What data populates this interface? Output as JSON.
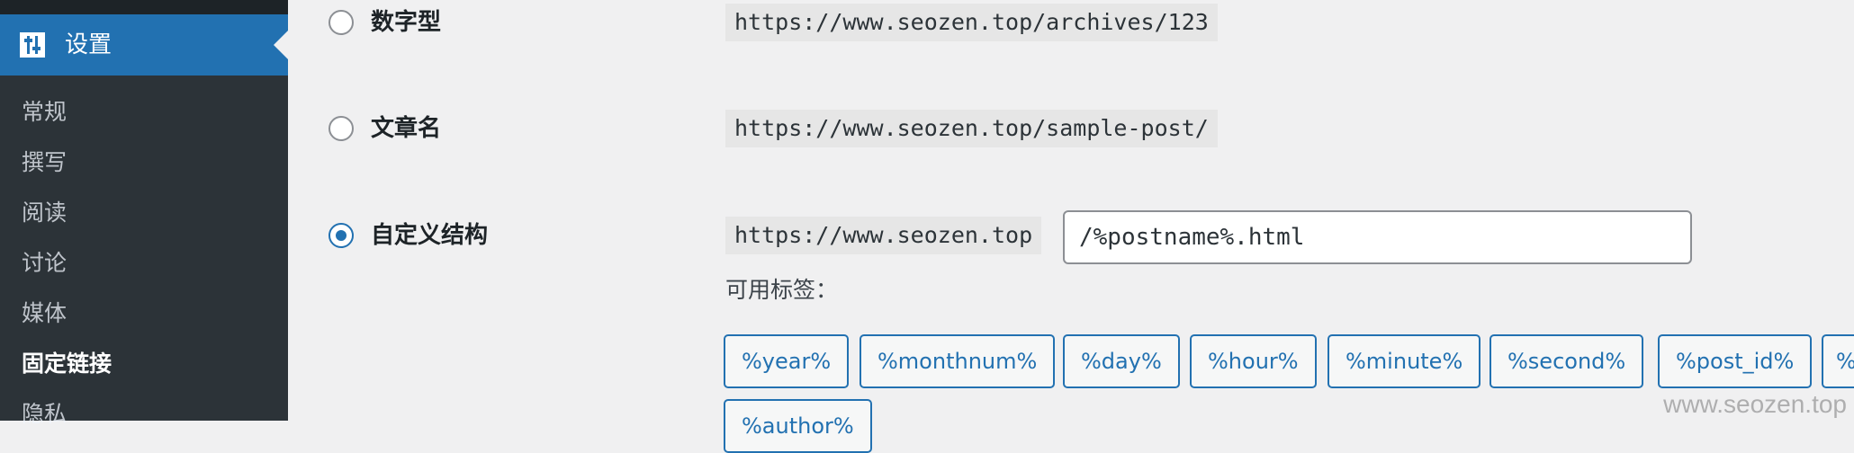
{
  "sidebar": {
    "current_section": {
      "label": "设置",
      "icon": "settings-sliders-icon"
    },
    "items": [
      {
        "label": "常规"
      },
      {
        "label": "撰写"
      },
      {
        "label": "阅读"
      },
      {
        "label": "讨论"
      },
      {
        "label": "媒体"
      },
      {
        "label": "固定链接",
        "current": true
      },
      {
        "label": "隐私"
      }
    ]
  },
  "permalinks": {
    "options": [
      {
        "label": "数字型",
        "example": "https://www.seozen.top/archives/123",
        "checked": false
      },
      {
        "label": "文章名",
        "example": "https://www.seozen.top/sample-post/",
        "checked": false
      },
      {
        "label": "自定义结构",
        "prefix": "https://www.seozen.top",
        "value": "/%postname%.html",
        "checked": true
      }
    ],
    "tags_label": "可用标签：",
    "tags": [
      "%year%",
      "%monthnum%",
      "%day%",
      "%hour%",
      "%minute%",
      "%second%",
      "%post_id%",
      "%",
      "%author%"
    ]
  },
  "watermark": "www.seozen.top",
  "colors": {
    "accent": "#2271b1",
    "sidebar_bg": "#2c3338",
    "page_bg": "#f0f0f1"
  }
}
